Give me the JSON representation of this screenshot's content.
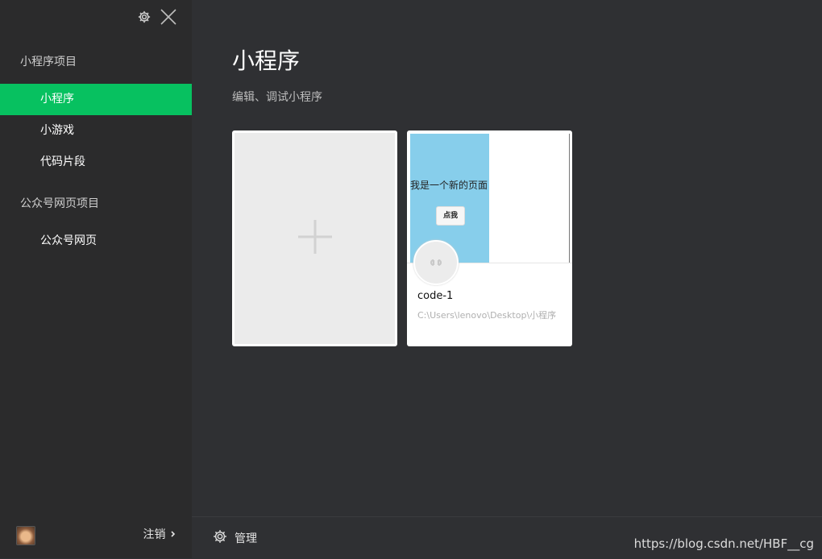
{
  "sidebar": {
    "sections": [
      {
        "title": "小程序项目",
        "items": [
          "小程序",
          "小游戏",
          "代码片段"
        ]
      },
      {
        "title": "公众号网页项目",
        "items": [
          "公众号网页"
        ]
      }
    ],
    "active_item": "小程序",
    "logout_label": "注销",
    "icons": {
      "settings": "gear-icon",
      "close": "close-icon",
      "chevron": "chevron-right-icon"
    }
  },
  "main": {
    "title": "小程序",
    "subtitle": "编辑、调试小程序",
    "projects": [
      {
        "name": "code-1",
        "path": "C:\\Users\\lenovo\\Desktop\\小程序",
        "preview_text": "我是一个新的页面",
        "preview_button": "点我"
      }
    ]
  },
  "bottom": {
    "manage_label": "管理",
    "watermark": "https://blog.csdn.net/HBF__cg"
  },
  "colors": {
    "accent": "#07c160",
    "preview_bg": "#87ceeb",
    "sidebar_bg": "#2b2b2c",
    "main_bg": "#2f3033"
  }
}
